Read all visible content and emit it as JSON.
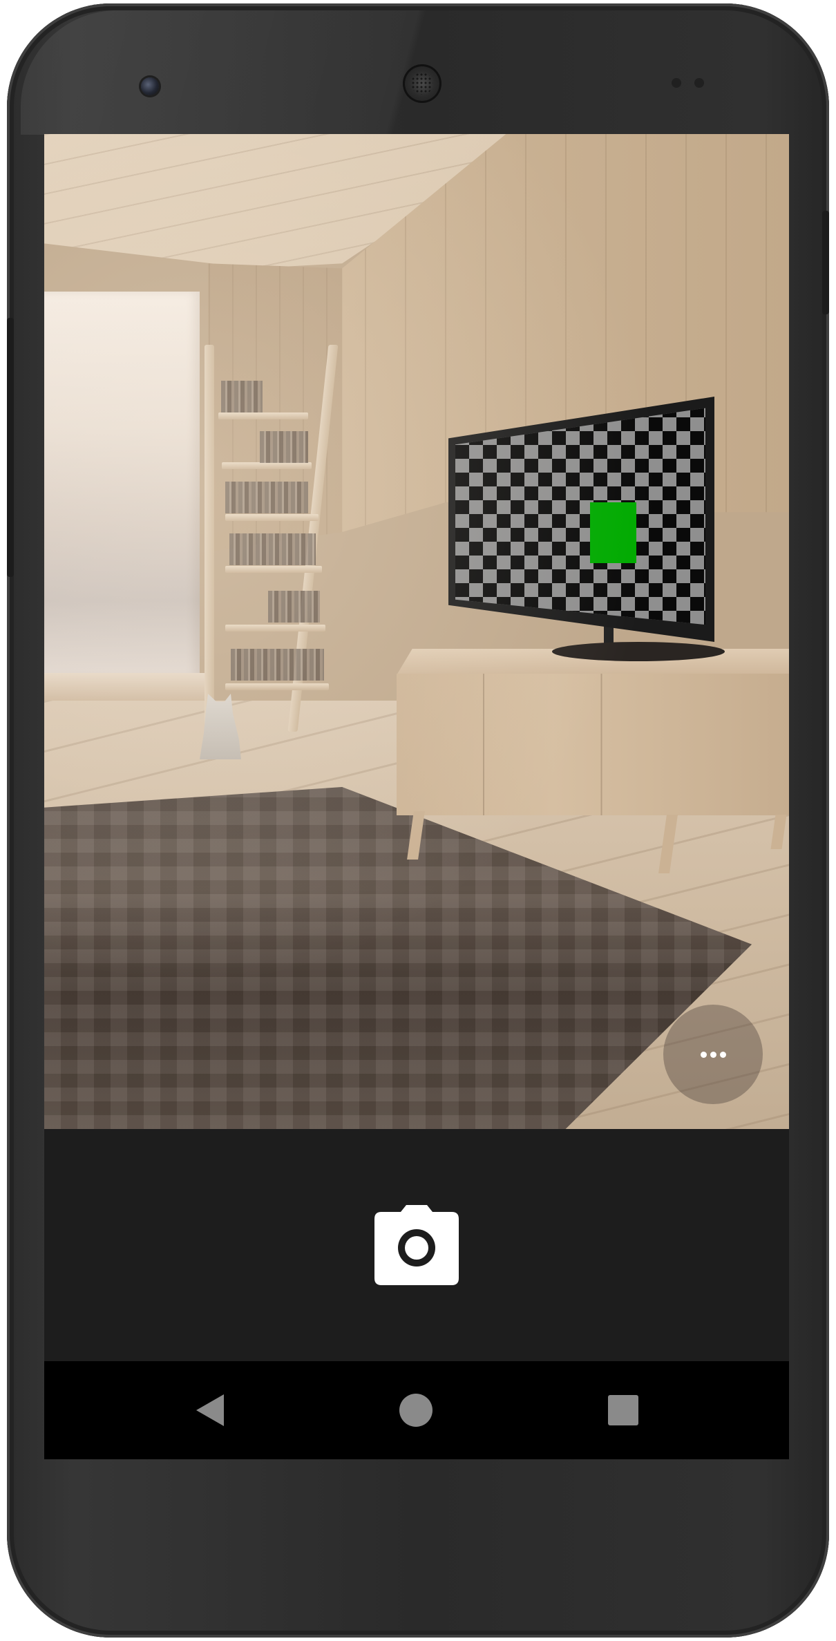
{
  "device": {
    "model_frame": "phone"
  },
  "viewfinder": {
    "scene": "room-with-tv",
    "tv_marker_color": "#00aa00",
    "overflow_menu_icon": "more-horizontal-icon"
  },
  "controls": {
    "shutter_icon": "camera-icon"
  },
  "navigation": {
    "back_icon": "back-triangle-icon",
    "home_icon": "home-circle-icon",
    "recents_icon": "recents-square-icon"
  },
  "colors": {
    "controls_background": "#1d1d1d",
    "navbar_background": "#000000",
    "nav_icon": "#8a8a8a",
    "shutter_icon": "#ffffff"
  }
}
